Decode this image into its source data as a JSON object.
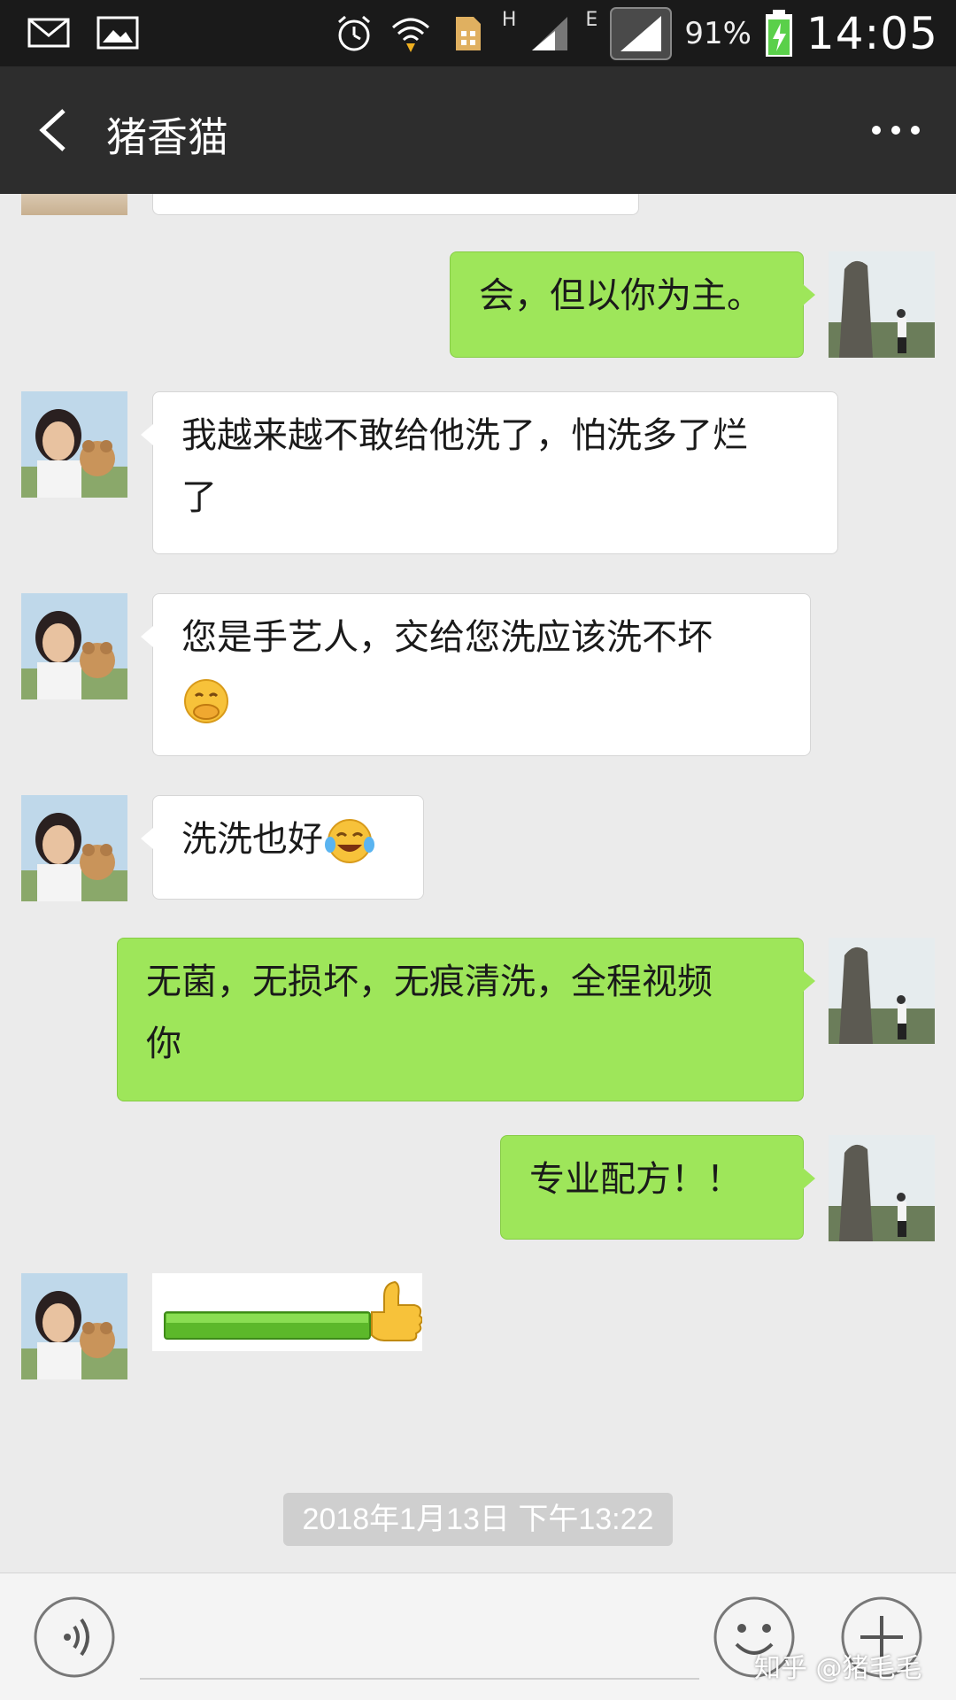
{
  "status_bar": {
    "icons_left": [
      "mail-icon",
      "image-icon"
    ],
    "network_h": "H",
    "network_e": "E",
    "battery_percent": "91%",
    "time": "14:05"
  },
  "header": {
    "title": "猪香猫",
    "back_icon": "chevron-left-icon",
    "more_icon": "more-horizontal-icon"
  },
  "messages": [
    {
      "side": "out",
      "text": "会，但以你为主。"
    },
    {
      "side": "in",
      "line1": "我越来越不敢给他洗了，怕洗多了烂",
      "line2": "了"
    },
    {
      "side": "in",
      "line1": "您是手艺人，交给您洗应该洗不坏",
      "emoji": "covering-mouth-emoji"
    },
    {
      "side": "in",
      "text": "洗洗也好",
      "emoji": "tears-of-joy-emoji"
    },
    {
      "side": "out",
      "line1": "无菌，无损坏，无痕清洗，全程视频",
      "line2": "你"
    },
    {
      "side": "out",
      "text": "专业配方！！"
    },
    {
      "side": "in",
      "sticker": "green-bar-thumbs-up-sticker"
    }
  ],
  "timestamp": "2018年1月13日 下午13:22",
  "bottom_bar": {
    "voice_icon": "voice-icon",
    "emoji_icon": "smiley-icon",
    "plus_icon": "plus-icon",
    "watermark": "知乎 @猪毛毛"
  },
  "colors": {
    "header_bg": "#2d2d2d",
    "chat_bg": "#ebebeb",
    "outgoing_bubble": "#9ee65a",
    "incoming_bubble": "#ffffff"
  }
}
